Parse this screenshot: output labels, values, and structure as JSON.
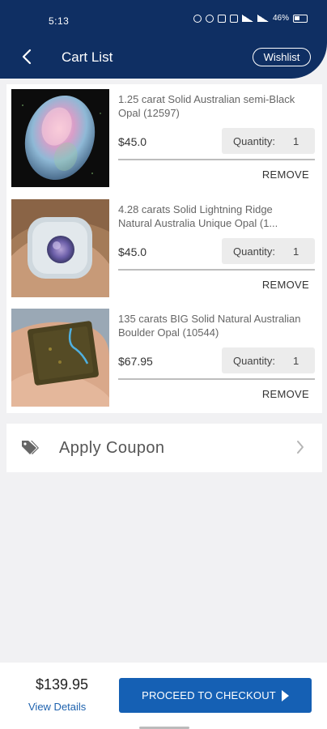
{
  "status_bar": {
    "time": "5:13",
    "battery": "46%"
  },
  "header": {
    "title": "Cart List",
    "wishlist_label": "Wishlist"
  },
  "cart": {
    "items": [
      {
        "name": "1.25 carat Solid Australian semi-Black Opal (12597)",
        "price": "$45.0",
        "quantity_label": "Quantity:",
        "quantity": "1",
        "remove_label": "REMOVE",
        "image": "oval-opal-photo"
      },
      {
        "name": "4.28 carats Solid Lightning Ridge Natural Australia Unique Opal (1...",
        "price": "$45.0",
        "quantity_label": "Quantity:",
        "quantity": "1",
        "remove_label": "REMOVE",
        "image": "round-opal-photo"
      },
      {
        "name": "135 carats BIG Solid Natural Australian Boulder Opal (10544)",
        "price": "$67.95",
        "quantity_label": "Quantity:",
        "quantity": "1",
        "remove_label": "REMOVE",
        "image": "boulder-opal-photo"
      }
    ]
  },
  "coupon": {
    "label": "Apply Coupon",
    "icon": "tag-icon"
  },
  "footer": {
    "total": "$139.95",
    "view_details_label": "View Details",
    "checkout_label": "PROCEED TO CHECKOUT"
  },
  "colors": {
    "header_bg": "#0f2f63",
    "accent": "#1560b4",
    "link": "#1e62ae",
    "page_bg": "#f1f1f3"
  }
}
